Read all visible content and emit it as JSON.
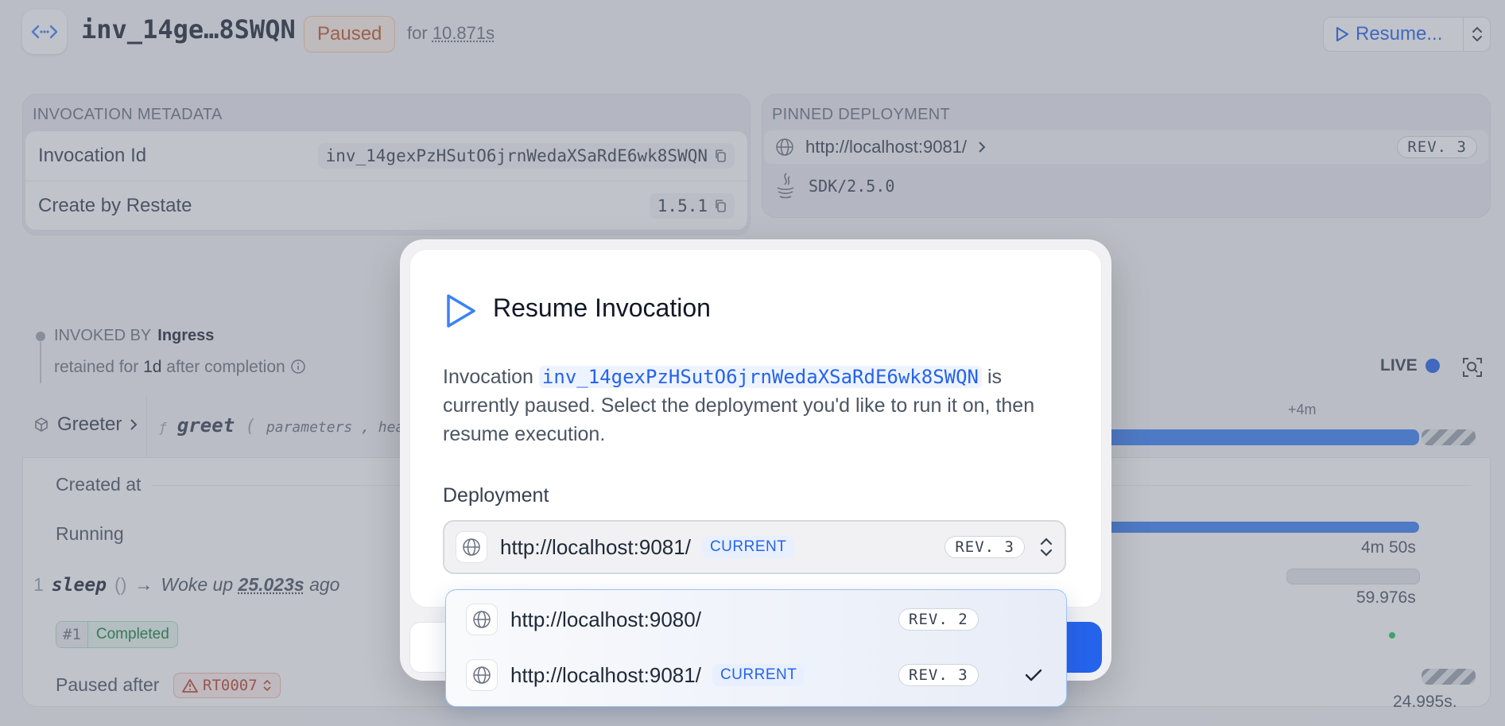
{
  "header": {
    "invocation_title": "inv_14ge…8SWQN",
    "status_badge": "Paused",
    "for_prefix": "for",
    "paused_duration": "10.871s",
    "resume_button_label": "Resume..."
  },
  "invocation_metadata": {
    "heading": "INVOCATION METADATA",
    "rows": [
      {
        "label": "Invocation Id",
        "value": "inv_14gexPzHSutO6jrnWedaXSaRdE6wk8SWQN"
      },
      {
        "label": "Create by Restate",
        "value": "1.5.1"
      }
    ]
  },
  "pinned_deployment": {
    "heading": "PINNED DEPLOYMENT",
    "url": "http://localhost:9081/",
    "revision": "REV. 3",
    "sdk": "SDK/2.5.0"
  },
  "invoked_by": {
    "label": "INVOKED BY",
    "source": "Ingress",
    "retained_prefix": "retained for",
    "retained_value": "1d",
    "retained_suffix": "after completion"
  },
  "timeline": {
    "service": "Greeter",
    "handler": "greet",
    "params": "parameters , heade",
    "live_label": "LIVE",
    "offset_label": "+4m",
    "rows": {
      "created_at": "Created at",
      "running": "Running",
      "sleep_index": "1",
      "sleep_call": "sleep",
      "sleep_note_prefix": "Woke up",
      "sleep_note_value": "25.023s",
      "sleep_note_suffix": "ago",
      "completed_num": "#1",
      "completed_label": "Completed",
      "paused_after": "Paused after",
      "error_code": "RT0007"
    },
    "durations": {
      "running": "4m 50s",
      "sleep": "59.976s",
      "paused": "24.995s."
    }
  },
  "modal": {
    "title": "Resume Invocation",
    "desc_prefix": "Invocation",
    "invocation_id": "inv_14gexPzHSutO6jrnWedaXSaRdE6wk8SWQN",
    "desc_suffix": "is currently paused. Select the deployment you'd like to run it on, then resume execution.",
    "deployment_label": "Deployment",
    "selected": {
      "url": "http://localhost:9081/",
      "tag": "CURRENT",
      "revision": "REV. 3"
    }
  },
  "dropdown": {
    "options": [
      {
        "url": "http://localhost:9080/",
        "tag": "",
        "revision": "REV. 2",
        "selected": false
      },
      {
        "url": "http://localhost:9081/",
        "tag": "CURRENT",
        "revision": "REV. 3",
        "selected": true
      }
    ]
  },
  "colors": {
    "accent": "#2563eb",
    "paused": "#c2562a",
    "success": "#15803d",
    "error": "#c2412d"
  }
}
